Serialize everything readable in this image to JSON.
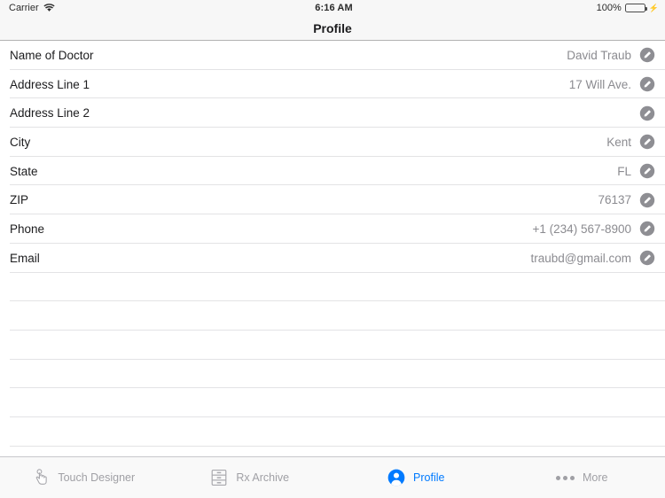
{
  "status_bar": {
    "carrier": "Carrier",
    "wifi_icon": "wifi-icon",
    "time": "6:16 AM",
    "battery_percent": "100%",
    "battery_icon": "battery-icon",
    "charging_icon": "lightning-bolt-icon",
    "battery_color": "#4cd964"
  },
  "nav_bar": {
    "title": "Profile"
  },
  "table": {
    "edit_icon": "pencil-edit-icon",
    "rows": [
      {
        "label": "Name of Doctor",
        "value": "David Traub"
      },
      {
        "label": "Address Line 1",
        "value": "17 Will Ave."
      },
      {
        "label": "Address Line 2",
        "value": ""
      },
      {
        "label": "City",
        "value": "Kent"
      },
      {
        "label": "State",
        "value": "FL"
      },
      {
        "label": "ZIP",
        "value": "76137"
      },
      {
        "label": "Phone",
        "value": "+1 (234) 567-8900"
      },
      {
        "label": "Email",
        "value": "traubd@gmail.com"
      }
    ],
    "empty_row_count": 6
  },
  "tab_bar": {
    "active_color": "#007aff",
    "inactive_color": "#a0a0a5",
    "tabs": [
      {
        "label": "Touch Designer",
        "icon": "tap-hand-icon",
        "active": false
      },
      {
        "label": "Rx Archive",
        "icon": "file-cabinet-icon",
        "active": false
      },
      {
        "label": "Profile",
        "icon": "person-circle-icon",
        "active": true
      },
      {
        "label": "More",
        "icon": "ellipsis-icon",
        "active": false
      }
    ]
  }
}
